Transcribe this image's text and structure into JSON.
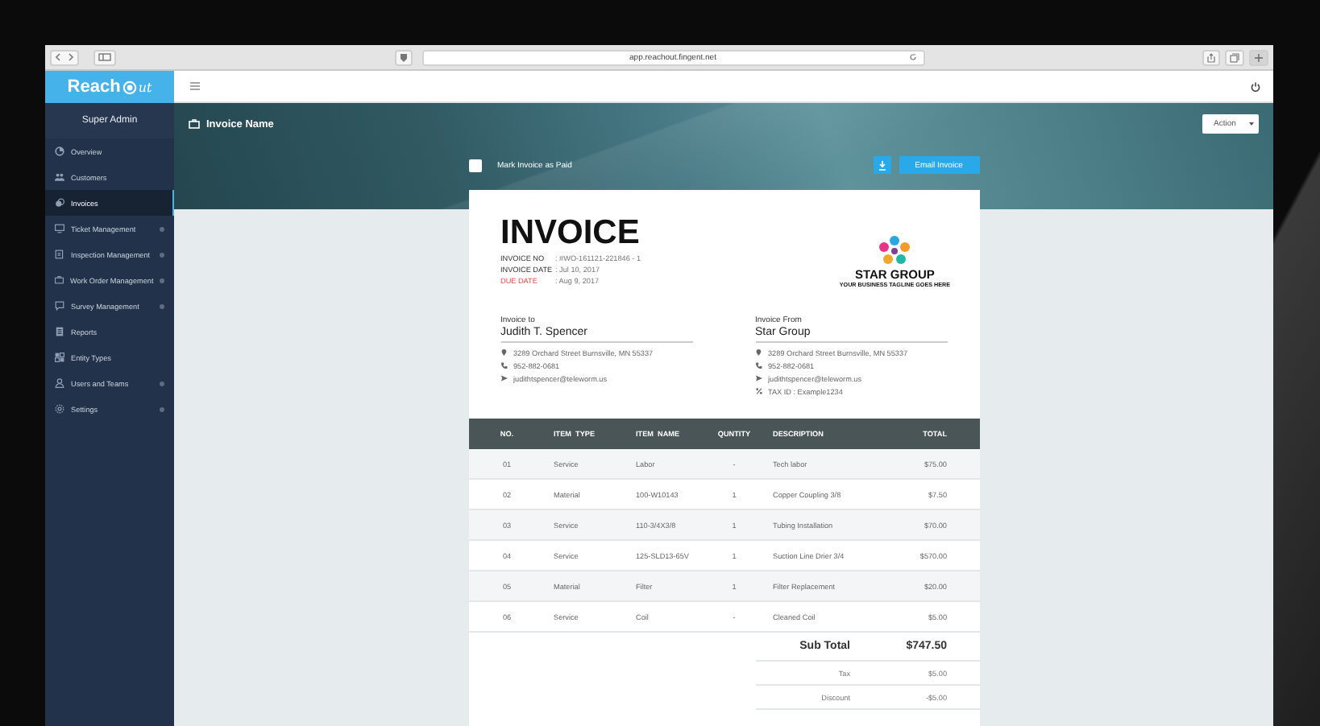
{
  "browser": {
    "url": "app.reachout.fingent.net"
  },
  "logo": {
    "word": "Reach",
    "suffix": "ut"
  },
  "sidebar": {
    "title": "Super Admin",
    "items": [
      {
        "label": "Overview",
        "selected": false,
        "expandable": false
      },
      {
        "label": "Customers",
        "selected": false,
        "expandable": false
      },
      {
        "label": "Invoices",
        "selected": true,
        "expandable": false
      },
      {
        "label": "Ticket Management",
        "selected": false,
        "expandable": true
      },
      {
        "label": "Inspection Management",
        "selected": false,
        "expandable": true
      },
      {
        "label": "Work Order Management",
        "selected": false,
        "expandable": true
      },
      {
        "label": "Survey Management",
        "selected": false,
        "expandable": true
      },
      {
        "label": "Reports",
        "selected": false,
        "expandable": false
      },
      {
        "label": "Entity Types",
        "selected": false,
        "expandable": false
      },
      {
        "label": "Users and Teams",
        "selected": false,
        "expandable": true
      },
      {
        "label": "Settings",
        "selected": false,
        "expandable": true
      }
    ]
  },
  "header": {
    "page_title": "Invoice Name",
    "action": "Action"
  },
  "toolbar": {
    "mark_paid": {
      "label": "Mark Invoice as Paid",
      "checked": false
    },
    "email_button": "Email Invoice"
  },
  "invoice": {
    "title": "INVOICE",
    "meta": [
      {
        "label": "INVOICE NO",
        "value": ": #WO-161121-221846 - 1",
        "kind": "normal"
      },
      {
        "label": "INVOICE DATE",
        "value": ": Jul 10, 2017",
        "kind": "normal"
      },
      {
        "label": "DUE DATE",
        "value": ": Aug 9, 2017",
        "kind": "due"
      }
    ],
    "company_logo": {
      "name": "STAR GROUP",
      "tagline": "YOUR BUSINESS TAGLINE GOES HERE"
    },
    "parties": [
      {
        "heading": "Invoice to",
        "name": "Judith T. Spencer",
        "details": [
          {
            "kind": "address",
            "text": "3289 Orchard Street Burnsville, MN 55337"
          },
          {
            "kind": "phone",
            "text": "952-882-0681"
          },
          {
            "kind": "email",
            "text": "judithtspencer@teleworm.us"
          }
        ]
      },
      {
        "heading": "Invoice From",
        "name": "Star Group",
        "details": [
          {
            "kind": "address",
            "text": "3289 Orchard Street Burnsville, MN 55337"
          },
          {
            "kind": "phone",
            "text": "952-882-0681"
          },
          {
            "kind": "email",
            "text": "judithtspencer@teleworm.us"
          },
          {
            "kind": "tax",
            "text": "TAX ID : Example1234"
          }
        ]
      }
    ],
    "table": {
      "columns": [
        "NO.",
        "ITEM  TYPE",
        "ITEM  NAME",
        "QUNTITY",
        "DESCRIPTION",
        "TOTAL"
      ],
      "rows": [
        [
          "01",
          "Service",
          "Labor",
          "-",
          "Tech labor",
          "$75.00"
        ],
        [
          "02",
          "Material",
          "100-W10143",
          "1",
          "Copper Coupling 3/8",
          "$7.50"
        ],
        [
          "03",
          "Service",
          "110-3/4X3/8",
          "1",
          "Tubing Installation",
          "$70.00"
        ],
        [
          "04",
          "Service",
          "125-SLD13-65V",
          "1",
          "Suction Line Drier 3/4",
          "$570.00"
        ],
        [
          "05",
          "Material",
          "Filter",
          "1",
          "Filter Replacement",
          "$20.00"
        ],
        [
          "06",
          "Service",
          "Coil",
          "-",
          "Cleaned Coil",
          "$5.00"
        ]
      ]
    },
    "totals": [
      {
        "label": "Sub Total",
        "value": "$747.50",
        "kind": "subtotal"
      },
      {
        "label": "Tax",
        "value": "$5.00",
        "kind": "line"
      },
      {
        "label": "Discount",
        "value": "-$5.00",
        "kind": "line"
      }
    ]
  }
}
